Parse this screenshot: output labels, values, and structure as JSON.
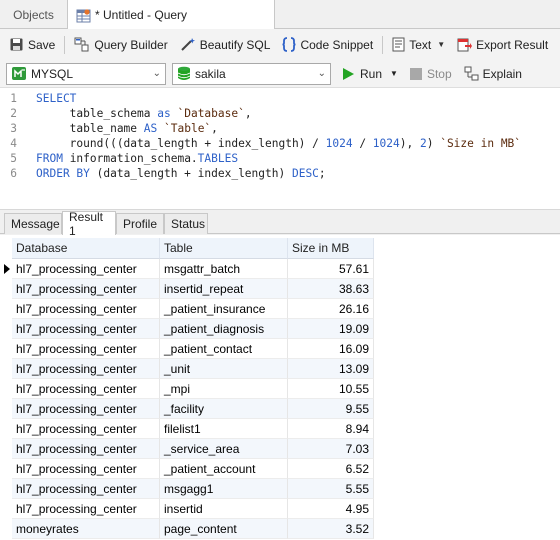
{
  "tabs": {
    "objects": "Objects",
    "query": "* Untitled - Query"
  },
  "toolbar": {
    "save": "Save",
    "query_builder": "Query Builder",
    "beautify": "Beautify SQL",
    "snippet": "Code Snippet",
    "text": "Text",
    "export": "Export Result"
  },
  "connection": {
    "server": "MYSQL",
    "database": "sakila",
    "run": "Run",
    "stop": "Stop",
    "explain": "Explain"
  },
  "editor": {
    "line_numbers": [
      "1",
      "2",
      "3",
      "4",
      "5",
      "6"
    ]
  },
  "result_tabs": {
    "message": "Message",
    "result": "Result 1",
    "profile": "Profile",
    "status": "Status"
  },
  "grid": {
    "columns": [
      "Database",
      "Table",
      "Size in MB"
    ],
    "rows": [
      [
        "hl7_processing_center",
        "msgattr_batch",
        "57.61"
      ],
      [
        "hl7_processing_center",
        "insertid_repeat",
        "38.63"
      ],
      [
        "hl7_processing_center",
        "_patient_insurance",
        "26.16"
      ],
      [
        "hl7_processing_center",
        "_patient_diagnosis",
        "19.09"
      ],
      [
        "hl7_processing_center",
        "_patient_contact",
        "16.09"
      ],
      [
        "hl7_processing_center",
        "_unit",
        "13.09"
      ],
      [
        "hl7_processing_center",
        "_mpi",
        "10.55"
      ],
      [
        "hl7_processing_center",
        "_facility",
        "9.55"
      ],
      [
        "hl7_processing_center",
        "filelist1",
        "8.94"
      ],
      [
        "hl7_processing_center",
        "_service_area",
        "7.03"
      ],
      [
        "hl7_processing_center",
        "_patient_account",
        "6.52"
      ],
      [
        "hl7_processing_center",
        "msgagg1",
        "5.55"
      ],
      [
        "hl7_processing_center",
        "insertid",
        "4.95"
      ],
      [
        "moneyrates",
        "page_content",
        "3.52"
      ]
    ]
  },
  "colors": {
    "keyword": "#2e61c8",
    "string": "#5b2b0e",
    "run_green": "#23a423",
    "header_bg": "#eef4fb"
  }
}
